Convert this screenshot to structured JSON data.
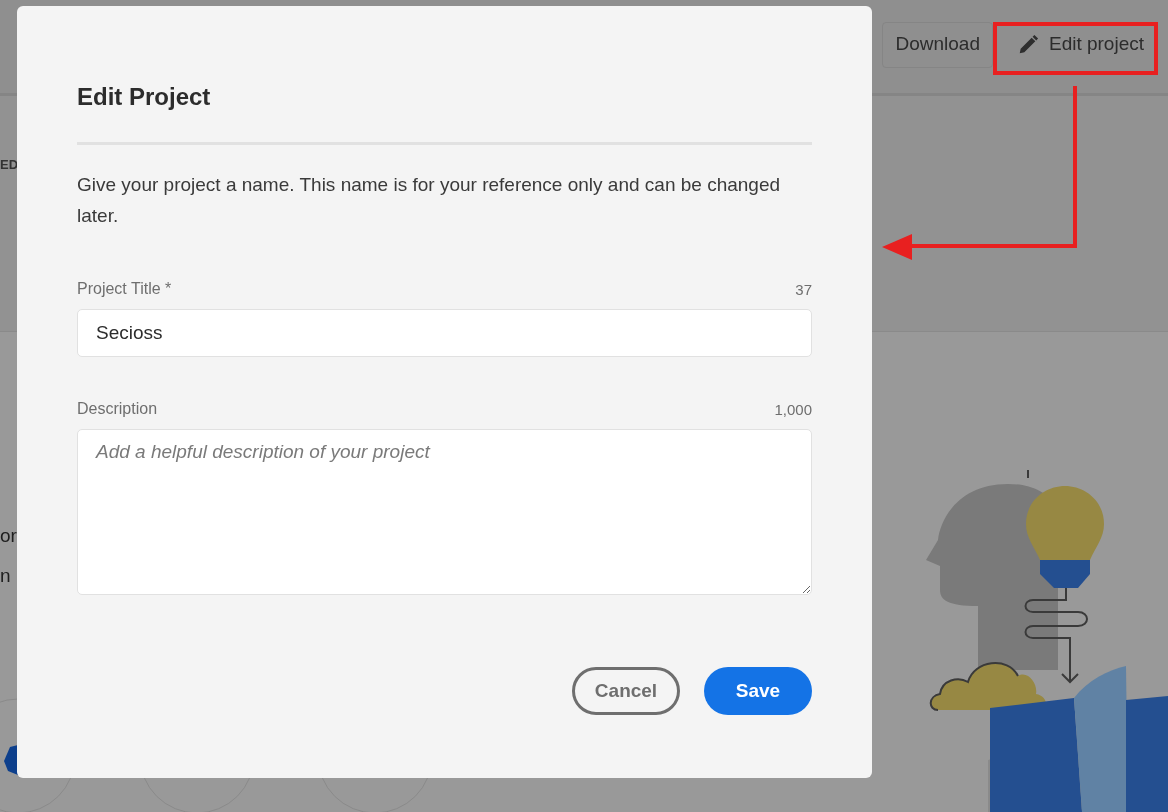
{
  "background_page": {
    "header_buttons": [
      {
        "label": "Download",
        "kind": "plain"
      },
      {
        "label": "Edit project",
        "kind": "edit"
      }
    ],
    "fragments": [
      {
        "text": "ED",
        "kind": "label"
      },
      {
        "text": "or",
        "kind": "body"
      },
      {
        "text": "n",
        "kind": "body"
      }
    ]
  },
  "dialog": {
    "title": "Edit Project",
    "intro": "Give your project a name. This name is for your reference only and can be changed later.",
    "fields": [
      {
        "kind": "input",
        "label": "Project Title *",
        "counter": "37",
        "value": "Secioss"
      },
      {
        "kind": "textarea",
        "label": "Description",
        "counter": "1,000",
        "placeholder": "Add a helpful description of your project"
      }
    ],
    "buttons": [
      {
        "label": "Cancel",
        "kind": "secondary"
      },
      {
        "label": "Save",
        "kind": "primary"
      }
    ]
  }
}
